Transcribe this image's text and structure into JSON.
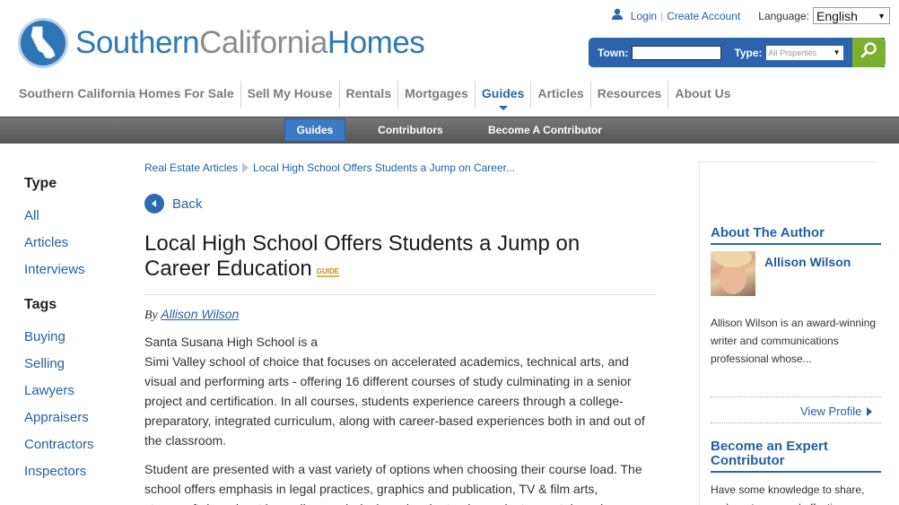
{
  "logo": {
    "part1": "Southern",
    "part2": "California",
    "part3": "Homes"
  },
  "util": {
    "login": "Login",
    "sep": "|",
    "create_account": "Create Account",
    "language_label": "Language:",
    "language_value": "English"
  },
  "search": {
    "town_label": "Town:",
    "town_value": "",
    "type_label": "Type:",
    "type_value": "All Properties"
  },
  "nav": {
    "items": [
      {
        "label": "Southern California Homes For Sale"
      },
      {
        "label": "Sell My House"
      },
      {
        "label": "Rentals"
      },
      {
        "label": "Mortgages"
      },
      {
        "label": "Guides"
      },
      {
        "label": "Articles"
      },
      {
        "label": "Resources"
      },
      {
        "label": "About Us"
      }
    ],
    "active": "Guides"
  },
  "subnav": {
    "items": [
      {
        "label": "Guides"
      },
      {
        "label": "Contributors"
      },
      {
        "label": "Become A Contributor"
      }
    ]
  },
  "left": {
    "type_heading": "Type",
    "type_items": [
      {
        "label": "All"
      },
      {
        "label": "Articles"
      },
      {
        "label": "Interviews"
      }
    ],
    "tags_heading": "Tags",
    "tag_items": [
      {
        "label": "Buying"
      },
      {
        "label": "Selling"
      },
      {
        "label": "Lawyers"
      },
      {
        "label": "Appraisers"
      },
      {
        "label": "Contractors"
      },
      {
        "label": "Inspectors"
      }
    ]
  },
  "article": {
    "breadcrumb": [
      "Real Estate Articles",
      "Local High School Offers Students a Jump on Career..."
    ],
    "back_label": "Back",
    "title_line1": "Local High School Offers Students a Jump on",
    "title_line2": "Career Education",
    "badge": "GUIDE",
    "by": "By",
    "author": "Allison Wilson",
    "para1_line1": "Santa Susana High School is a",
    "para1_rest": "Simi Valley school of choice that focuses on accelerated academics, technical arts, and visual and performing arts - offering 16 different courses of study culminating in a senior project and certification. In all courses, students experience careers through a college-preparatory, integrated curriculum, along with career-based experiences both in and out of the classroom.",
    "para2": "Student are presented with a vast variety of options when choosing their course load. The school offers emphasis in legal practices, graphics and publication, TV & film arts, stagecraft, broadcast journalism, web design, visual arts, dance, instrumental music,"
  },
  "right": {
    "about_heading": "About The Author",
    "author_name": "Allison Wilson",
    "bio": "Allison Wilson is an award-winning writer and communications professional whose...",
    "view_profile": "View Profile",
    "expert_heading": "Become an Expert Contributor",
    "expert_text": "Have some knowledge to share, and want easy and effective"
  }
}
